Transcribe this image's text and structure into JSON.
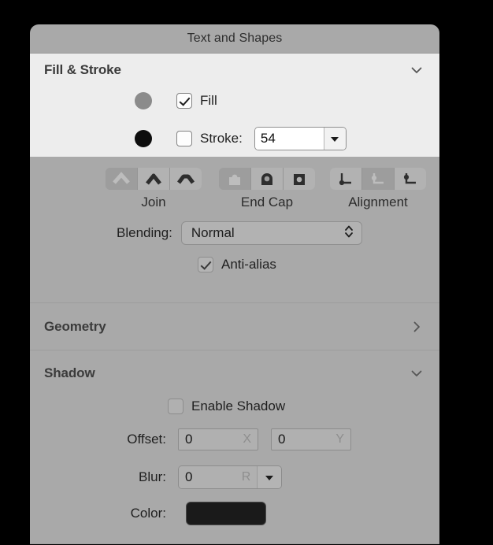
{
  "window": {
    "title": "Text and Shapes"
  },
  "sections": {
    "fill_stroke": {
      "title": "Fill & Stroke",
      "disclosure_icon": "chevron-down-icon",
      "fill": {
        "swatch_color": "#8b8b8b",
        "checked": true,
        "label": "Fill"
      },
      "stroke": {
        "swatch_color": "#0d0d0d",
        "checked": false,
        "label": "Stroke:",
        "value": "54",
        "dropdown_icon": "triangle-down-icon"
      },
      "join": {
        "caption": "Join",
        "options": [
          "miter-join-icon",
          "round-join-icon",
          "bevel-join-icon"
        ],
        "selected_index": 0
      },
      "end_cap": {
        "caption": "End Cap",
        "options": [
          "butt-cap-icon",
          "round-cap-icon",
          "square-cap-icon"
        ],
        "selected_index": 0
      },
      "alignment": {
        "caption": "Alignment",
        "options": [
          "align-inside-icon",
          "align-center-icon",
          "align-outside-icon"
        ],
        "selected_index": 1
      },
      "blending": {
        "label": "Blending:",
        "value": "Normal",
        "indicator_icon": "chevron-up-down-icon"
      },
      "anti_alias": {
        "label": "Anti-alias",
        "checked": true
      }
    },
    "geometry": {
      "title": "Geometry",
      "disclosure_icon": "chevron-right-icon",
      "expanded": false
    },
    "shadow": {
      "title": "Shadow",
      "disclosure_icon": "chevron-down-icon",
      "expanded": true,
      "enable": {
        "label": "Enable Shadow",
        "checked": false
      },
      "offset": {
        "label": "Offset:",
        "x_value": "0",
        "x_unit": "X",
        "y_value": "0",
        "y_unit": "Y"
      },
      "blur": {
        "label": "Blur:",
        "value": "0",
        "unit": "R",
        "dropdown_icon": "triangle-down-icon"
      },
      "color": {
        "label": "Color:",
        "swatch_color": "#1a1a1a"
      }
    }
  }
}
